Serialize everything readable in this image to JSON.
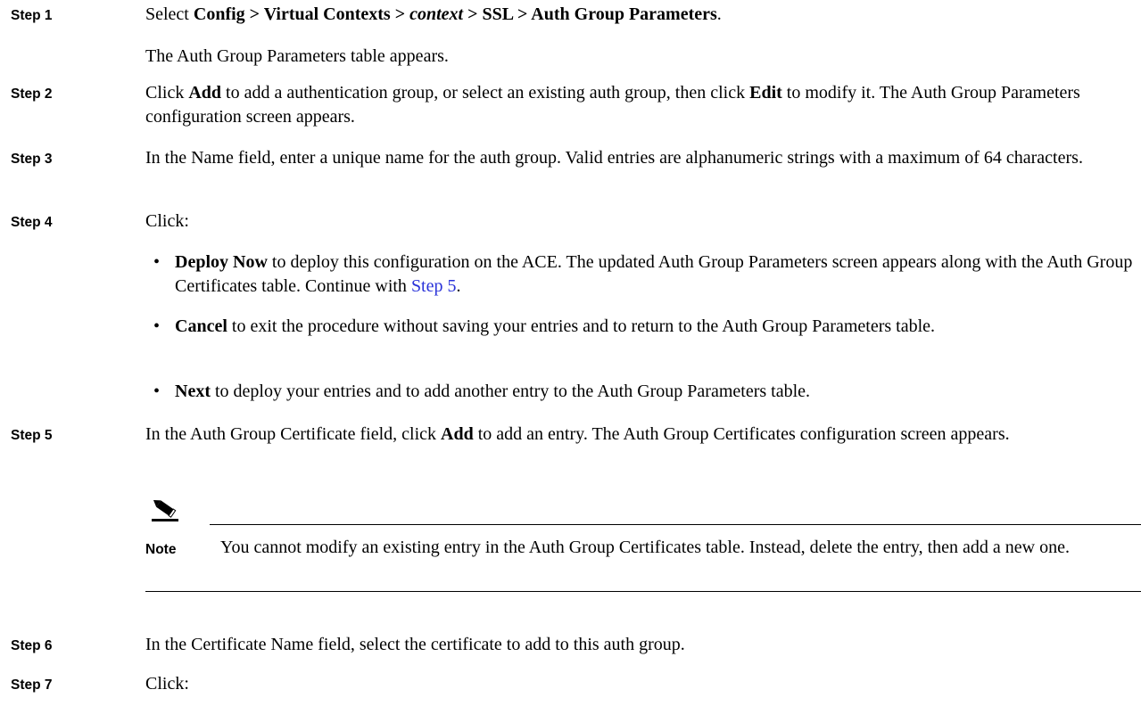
{
  "steps": [
    {
      "label": "Step 1"
    },
    {
      "label": "Step 2"
    },
    {
      "label": "Step 3"
    },
    {
      "label": "Step 4"
    },
    {
      "label": "Step 5"
    },
    {
      "label": "Step 6"
    },
    {
      "label": "Step 7"
    }
  ],
  "s1": {
    "select": "Select",
    "path_a": "Config > Virtual Contexts >",
    "path_ctx": "context",
    "path_b": "> SSL > Auth Group Parameters",
    "period": ".",
    "sub": "The Auth Group Parameters table appears."
  },
  "s2": {
    "click": "Click",
    "add": "Add",
    "mid": "to add a authentication group, or select an existing auth group, then click",
    "edit": "Edit",
    "end": "to modify it. The Auth Group Parameters configuration screen appears."
  },
  "s3": {
    "text": "In the Name field, enter a unique name for the auth group. Valid entries are alphanumeric strings with a maximum of 64 characters."
  },
  "s4": {
    "click": "Click:",
    "bullets": [
      {
        "term": "Deploy Now",
        "rest": "to deploy this configuration on the ACE. The updated Auth Group Parameters screen appears along with the Auth Group Certificates table. Continue with",
        "link": "Step 5",
        "tail": "."
      },
      {
        "term": "Cancel",
        "rest": "to exit the procedure without saving your entries and to return to the Auth Group Parameters table."
      },
      {
        "term": "Next",
        "rest": "to deploy your entries and to add another entry to the Auth Group Parameters table."
      }
    ]
  },
  "s5": {
    "pre": "In the Auth Group Certificate field, click",
    "add": "Add",
    "post": "to add an entry. The Auth Group Certificates configuration screen appears."
  },
  "note": {
    "label": "Note",
    "text": "You cannot modify an existing entry in the Auth Group Certificates table. Instead, delete the entry, then add a new one."
  },
  "s6": {
    "text": "In the Certificate Name field, select the certificate to add to this auth group."
  },
  "s7": {
    "click": "Click:"
  }
}
